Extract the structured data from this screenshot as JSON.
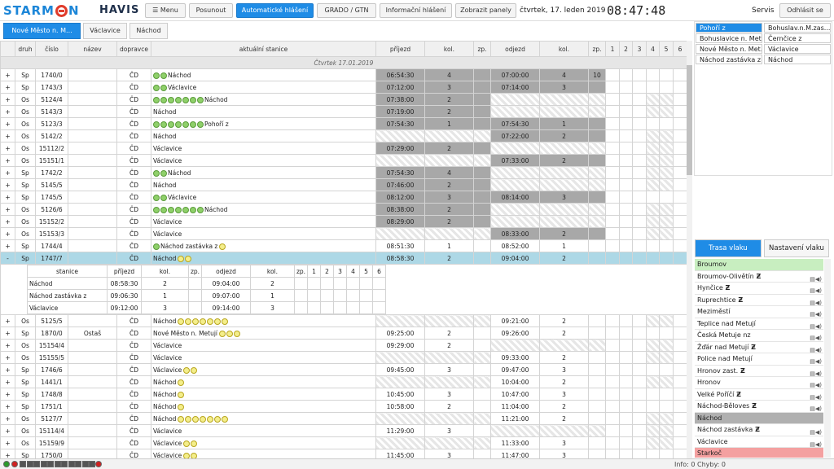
{
  "header": {
    "logo_left": "STARM",
    "logo_right": "N",
    "app_name": "HAVIS",
    "buttons": [
      "☰ Menu",
      "Posunout",
      "Automatické hlášení",
      "GRADO / GTN",
      "Informační hlášení",
      "Zobrazit panely"
    ],
    "date": "čtvrtek, 17. leden 2019",
    "time": "08:47:48",
    "servis": "Servis",
    "logout": "Odhlásit se"
  },
  "tabs": [
    "Nové Město n. M...",
    "Václavice",
    "Náchod"
  ],
  "grid": {
    "columns": [
      "",
      "druh",
      "číslo",
      "název",
      "dopravce",
      "aktuální stanice",
      "příjezd",
      "kol.",
      "zp.",
      "odjezd",
      "kol.",
      "zp.",
      "1",
      "2",
      "3",
      "4",
      "5",
      "6"
    ],
    "day_label": "Čtvrtek 17.01.2019",
    "rows": [
      {
        "exp": "+",
        "druh": "Sp",
        "cislo": "1740/0",
        "nazev": "",
        "dop": "ČD",
        "g": 2,
        "y": 0,
        "st": "Náchod",
        "pr": "06:54:30",
        "kol1": "4",
        "zp1": "",
        "od": "07:00:00",
        "kol2": "4",
        "zp2": "10",
        "a": "d",
        "b": "d"
      },
      {
        "exp": "+",
        "druh": "Sp",
        "cislo": "1743/3",
        "nazev": "",
        "dop": "ČD",
        "g": 2,
        "y": 0,
        "st": "Václavice",
        "pr": "07:12:00",
        "kol1": "3",
        "zp1": "",
        "od": "07:14:00",
        "kol2": "3",
        "zp2": "",
        "a": "d",
        "b": "d"
      },
      {
        "exp": "+",
        "druh": "Os",
        "cislo": "5124/4",
        "nazev": "",
        "dop": "ČD",
        "g": 7,
        "y": 0,
        "st": "Náchod",
        "pr": "07:38:00",
        "kol1": "2",
        "zp1": "",
        "od": "",
        "kol2": "",
        "zp2": "",
        "a": "d",
        "b": "h"
      },
      {
        "exp": "+",
        "druh": "Os",
        "cislo": "5143/3",
        "nazev": "",
        "dop": "ČD",
        "g": 0,
        "y": 0,
        "st": "Náchod",
        "pr": "07:19:00",
        "kol1": "2",
        "zp1": "",
        "od": "",
        "kol2": "",
        "zp2": "",
        "a": "d",
        "b": "h"
      },
      {
        "exp": "+",
        "druh": "Os",
        "cislo": "5123/3",
        "nazev": "",
        "dop": "ČD",
        "g": 7,
        "y": 0,
        "st": "Pohoří z",
        "pr": "07:54:30",
        "kol1": "1",
        "zp1": "",
        "od": "07:54:30",
        "kol2": "1",
        "zp2": "",
        "a": "d",
        "b": "d"
      },
      {
        "exp": "+",
        "druh": "Os",
        "cislo": "5142/2",
        "nazev": "",
        "dop": "ČD",
        "g": 0,
        "y": 0,
        "st": "Náchod",
        "pr": "",
        "kol1": "",
        "zp1": "",
        "od": "07:22:00",
        "kol2": "2",
        "zp2": "",
        "a": "h",
        "b": "d"
      },
      {
        "exp": "+",
        "druh": "Os",
        "cislo": "15112/2",
        "nazev": "",
        "dop": "ČD",
        "g": 0,
        "y": 0,
        "st": "Václavice",
        "pr": "07:29:00",
        "kol1": "2",
        "zp1": "",
        "od": "",
        "kol2": "",
        "zp2": "",
        "a": "d",
        "b": "h"
      },
      {
        "exp": "+",
        "druh": "Os",
        "cislo": "15151/1",
        "nazev": "",
        "dop": "ČD",
        "g": 0,
        "y": 0,
        "st": "Václavice",
        "pr": "",
        "kol1": "",
        "zp1": "",
        "od": "07:33:00",
        "kol2": "2",
        "zp2": "",
        "a": "h",
        "b": "d"
      },
      {
        "exp": "+",
        "druh": "Sp",
        "cislo": "1742/2",
        "nazev": "",
        "dop": "ČD",
        "g": 2,
        "y": 0,
        "st": "Náchod",
        "pr": "07:54:30",
        "kol1": "4",
        "zp1": "",
        "od": "",
        "kol2": "",
        "zp2": "",
        "a": "d",
        "b": "h"
      },
      {
        "exp": "+",
        "druh": "Sp",
        "cislo": "5145/5",
        "nazev": "",
        "dop": "ČD",
        "g": 0,
        "y": 0,
        "st": "Náchod",
        "pr": "07:46:00",
        "kol1": "2",
        "zp1": "",
        "od": "",
        "kol2": "",
        "zp2": "",
        "a": "d",
        "b": "h"
      },
      {
        "exp": "+",
        "druh": "Sp",
        "cislo": "1745/5",
        "nazev": "",
        "dop": "ČD",
        "g": 2,
        "y": 0,
        "st": "Václavice",
        "pr": "08:12:00",
        "kol1": "3",
        "zp1": "",
        "od": "08:14:00",
        "kol2": "3",
        "zp2": "",
        "a": "d",
        "b": "d"
      },
      {
        "exp": "+",
        "druh": "Os",
        "cislo": "5126/6",
        "nazev": "",
        "dop": "ČD",
        "g": 7,
        "y": 0,
        "st": "Náchod",
        "pr": "08:38:00",
        "kol1": "2",
        "zp1": "",
        "od": "",
        "kol2": "",
        "zp2": "",
        "a": "d",
        "b": "h"
      },
      {
        "exp": "+",
        "druh": "Os",
        "cislo": "15152/2",
        "nazev": "",
        "dop": "ČD",
        "g": 0,
        "y": 0,
        "st": "Václavice",
        "pr": "08:29:00",
        "kol1": "2",
        "zp1": "",
        "od": "",
        "kol2": "",
        "zp2": "",
        "a": "d",
        "b": "h"
      },
      {
        "exp": "+",
        "druh": "Os",
        "cislo": "15153/3",
        "nazev": "",
        "dop": "ČD",
        "g": 0,
        "y": 0,
        "st": "Václavice",
        "pr": "",
        "kol1": "",
        "zp1": "",
        "od": "08:33:00",
        "kol2": "2",
        "zp2": "",
        "a": "h",
        "b": "d"
      },
      {
        "exp": "+",
        "druh": "Sp",
        "cislo": "1744/4",
        "nazev": "",
        "dop": "ČD",
        "g": 1,
        "y": 1,
        "st": "Náchod zastávka z",
        "pr": "08:51:30",
        "kol1": "1",
        "zp1": "",
        "od": "08:52:00",
        "kol2": "1",
        "zp2": "",
        "a": "w",
        "b": "w"
      },
      {
        "exp": "-",
        "druh": "Sp",
        "cislo": "1747/7",
        "nazev": "",
        "dop": "ČD",
        "g": 0,
        "y": 2,
        "st": "Náchod",
        "pr": "08:58:30",
        "kol1": "2",
        "zp1": "",
        "od": "09:04:00",
        "kol2": "2",
        "zp2": "",
        "a": "w",
        "b": "w",
        "sel": true
      }
    ],
    "sub_columns": [
      "stanice",
      "příjezd",
      "kol.",
      "zp.",
      "odjezd",
      "kol.",
      "zp.",
      "1",
      "2",
      "3",
      "4",
      "5",
      "6"
    ],
    "sub_rows": [
      {
        "st": "Náchod",
        "pr": "08:58:30",
        "k1": "2",
        "od": "09:04:00",
        "k2": "2"
      },
      {
        "st": "Náchod zastávka z",
        "pr": "09:06:30",
        "k1": "1",
        "od": "09:07:00",
        "k2": "1"
      },
      {
        "st": "Václavice",
        "pr": "09:12:00",
        "k1": "3",
        "od": "09:14:00",
        "k2": "3"
      }
    ],
    "rows2": [
      {
        "exp": "+",
        "druh": "Os",
        "cislo": "5125/5",
        "nazev": "",
        "dop": "ČD",
        "g": 0,
        "y": 7,
        "st": "Náchod",
        "pr": "",
        "kol1": "",
        "zp1": "",
        "od": "09:21:00",
        "kol2": "2",
        "zp2": "",
        "a": "h",
        "b": "w"
      },
      {
        "exp": "+",
        "druh": "Sp",
        "cislo": "1870/0",
        "nazev": "Ostaš",
        "dop": "ČD",
        "g": 0,
        "y": 3,
        "st": "Nové Město n. Metují",
        "pr": "09:25:00",
        "kol1": "2",
        "zp1": "",
        "od": "09:26:00",
        "kol2": "2",
        "zp2": "",
        "a": "w",
        "b": "w"
      },
      {
        "exp": "+",
        "druh": "Os",
        "cislo": "15154/4",
        "nazev": "",
        "dop": "ČD",
        "g": 0,
        "y": 0,
        "st": "Václavice",
        "pr": "09:29:00",
        "kol1": "2",
        "zp1": "",
        "od": "",
        "kol2": "",
        "zp2": "",
        "a": "w",
        "b": "h"
      },
      {
        "exp": "+",
        "druh": "Os",
        "cislo": "15155/5",
        "nazev": "",
        "dop": "ČD",
        "g": 0,
        "y": 0,
        "st": "Václavice",
        "pr": "",
        "kol1": "",
        "zp1": "",
        "od": "09:33:00",
        "kol2": "2",
        "zp2": "",
        "a": "h",
        "b": "w"
      },
      {
        "exp": "+",
        "druh": "Sp",
        "cislo": "1746/6",
        "nazev": "",
        "dop": "ČD",
        "g": 0,
        "y": 2,
        "st": "Václavice",
        "pr": "09:45:00",
        "kol1": "3",
        "zp1": "",
        "od": "09:47:00",
        "kol2": "3",
        "zp2": "",
        "a": "w",
        "b": "w"
      },
      {
        "exp": "+",
        "druh": "Sp",
        "cislo": "1441/1",
        "nazev": "",
        "dop": "ČD",
        "g": 0,
        "y": 1,
        "st": "Náchod",
        "pr": "",
        "kol1": "",
        "zp1": "",
        "od": "10:04:00",
        "kol2": "2",
        "zp2": "",
        "a": "h",
        "b": "w"
      },
      {
        "exp": "+",
        "druh": "Sp",
        "cislo": "1748/8",
        "nazev": "",
        "dop": "ČD",
        "g": 0,
        "y": 1,
        "st": "Náchod",
        "pr": "10:45:00",
        "kol1": "3",
        "zp1": "",
        "od": "10:47:00",
        "kol2": "3",
        "zp2": "",
        "a": "w",
        "b": "w"
      },
      {
        "exp": "+",
        "druh": "Sp",
        "cislo": "1751/1",
        "nazev": "",
        "dop": "ČD",
        "g": 0,
        "y": 1,
        "st": "Náchod",
        "pr": "10:58:00",
        "kol1": "2",
        "zp1": "",
        "od": "11:04:00",
        "kol2": "2",
        "zp2": "",
        "a": "w",
        "b": "w"
      },
      {
        "exp": "+",
        "druh": "Os",
        "cislo": "5127/7",
        "nazev": "",
        "dop": "ČD",
        "g": 0,
        "y": 7,
        "st": "Náchod",
        "pr": "",
        "kol1": "",
        "zp1": "",
        "od": "11:21:00",
        "kol2": "2",
        "zp2": "",
        "a": "h",
        "b": "w"
      },
      {
        "exp": "+",
        "druh": "Os",
        "cislo": "15114/4",
        "nazev": "",
        "dop": "ČD",
        "g": 0,
        "y": 0,
        "st": "Václavice",
        "pr": "11:29:00",
        "kol1": "3",
        "zp1": "",
        "od": "",
        "kol2": "",
        "zp2": "",
        "a": "w",
        "b": "h"
      },
      {
        "exp": "+",
        "druh": "Os",
        "cislo": "15159/9",
        "nazev": "",
        "dop": "ČD",
        "g": 0,
        "y": 2,
        "st": "Václavice",
        "pr": "",
        "kol1": "",
        "zp1": "",
        "od": "11:33:00",
        "kol2": "3",
        "zp2": "",
        "a": "h",
        "b": "w"
      },
      {
        "exp": "+",
        "druh": "Sp",
        "cislo": "1750/0",
        "nazev": "",
        "dop": "ČD",
        "g": 0,
        "y": 2,
        "st": "Václavice",
        "pr": "11:45:00",
        "kol1": "3",
        "zp1": "",
        "od": "11:47:00",
        "kol2": "3",
        "zp2": "",
        "a": "w",
        "b": "w"
      }
    ]
  },
  "right_panel": {
    "stations": [
      [
        "Pohoří z",
        "Bohuslav.n.M.zas..."
      ],
      [
        "Bohuslavice n. Met.",
        "Černčice z"
      ],
      [
        "Nové Město n. Met.",
        "Václavice"
      ],
      [
        "Náchod zastávka z",
        "Náchod"
      ]
    ],
    "tabs": [
      "Trasa vlaku",
      "Nastavení vlaku"
    ],
    "route": [
      {
        "name": "Broumov",
        "c": "#c8eec0",
        "z": false
      },
      {
        "name": "Broumov-Olivětín",
        "c": "",
        "z": true
      },
      {
        "name": "Hynčice",
        "c": "",
        "z": true
      },
      {
        "name": "Ruprechtice",
        "c": "",
        "z": true
      },
      {
        "name": "Meziměstí",
        "c": "",
        "z": false
      },
      {
        "name": "Teplice nad Metují",
        "c": "",
        "z": false
      },
      {
        "name": "Česká Metuje nz",
        "c": "",
        "z": false
      },
      {
        "name": "Žďár nad Metují",
        "c": "",
        "z": true
      },
      {
        "name": "Police nad Metují",
        "c": "",
        "z": false
      },
      {
        "name": "Hronov zast.",
        "c": "",
        "z": true
      },
      {
        "name": "Hronov",
        "c": "",
        "z": false
      },
      {
        "name": "Velké Poříčí",
        "c": "",
        "z": true
      },
      {
        "name": "Náchod-Běloves",
        "c": "",
        "z": true
      },
      {
        "name": "Náchod",
        "c": "#b0b0b0",
        "z": false
      },
      {
        "name": "Náchod zastávka",
        "c": "",
        "z": true
      },
      {
        "name": "Václavice",
        "c": "",
        "z": false
      },
      {
        "name": "Starkoč",
        "c": "#f4a0a0",
        "z": false
      }
    ]
  },
  "status": {
    "info": "Info: 0 Chyby: 0"
  }
}
